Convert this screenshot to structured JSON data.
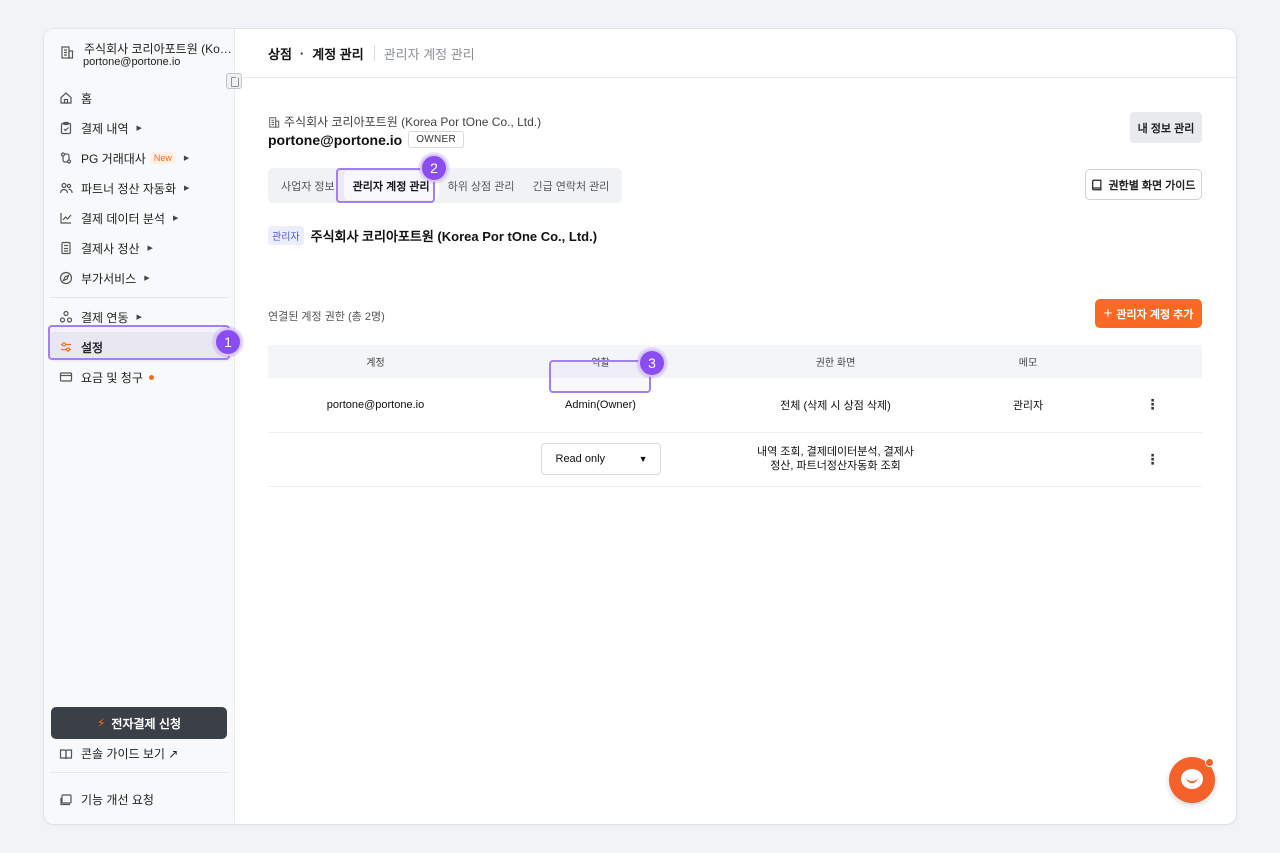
{
  "sidebar": {
    "org_name": "주식회사 코리아포트원 (Korea Por tOne Co., Ltd.)",
    "org_email": "portone@portone.io",
    "items": [
      {
        "label": "홈",
        "icon": "home-icon",
        "caret": false
      },
      {
        "label": "결제 내역",
        "icon": "clipboard-check-icon",
        "caret": true
      },
      {
        "label": "PG 거래대사",
        "icon": "reconcile-icon",
        "caret": true,
        "badge": "New"
      },
      {
        "label": "파트너 정산 자동화",
        "icon": "users-icon",
        "caret": true
      },
      {
        "label": "결제 데이터 분석",
        "icon": "chart-line-icon",
        "caret": true
      },
      {
        "label": "결제사 정산",
        "icon": "calculator-icon",
        "caret": true
      },
      {
        "label": "부가서비스",
        "icon": "compass-icon",
        "caret": true
      }
    ],
    "items2": [
      {
        "label": "결제 연동",
        "icon": "integration-icon",
        "caret": true
      },
      {
        "label": "설정",
        "icon": "settings-sliders-icon",
        "caret": false,
        "active": true
      },
      {
        "label": "요금 및 청구",
        "icon": "credit-card-icon",
        "caret": false,
        "dot": true
      }
    ],
    "apply_button": "전자결제 신청",
    "guide_link": "콘솔 가이드 보기 ↗",
    "feedback": "기능 개선 요청"
  },
  "header": {
    "crumb_main": "상점",
    "crumb_dot": "·",
    "crumb_sub": "계정 관리",
    "crumb_current": "관리자 계정 관리"
  },
  "main": {
    "org_name": "주식회사 코리아포트원 (Korea Por tOne Co., Ltd.)",
    "email": "portone@portone.io",
    "owner_tag": "OWNER",
    "my_info_button": "내 정보 관리",
    "tabs": [
      "사업자 정보",
      "관리자 계정 관리",
      "하위 상점 관리",
      "긴급 연락처 관리"
    ],
    "active_tab": 1,
    "guide_button": "권한별 화면 가이드",
    "admin_tag": "관리자",
    "admin_name": "주식회사 코리아포트원 (Korea Por tOne Co., Ltd.)",
    "linked_label": "연결된 계정 권한 (총 2명)",
    "add_button": "관리자 계정 추가",
    "table": {
      "headers": [
        "계정",
        "역할",
        "권한 화면",
        "메모",
        ""
      ],
      "rows": [
        {
          "account": "portone@portone.io",
          "role": "Admin(Owner)",
          "screens": "전체 (삭제 시 상점 삭제)",
          "memo": "관리자"
        },
        {
          "account": "",
          "role": "Read only",
          "screens": "내역 조회, 결제데이터분석, 결제사정산, 파트너정산자동화 조회",
          "memo": ""
        }
      ]
    }
  },
  "steps": [
    "1",
    "2",
    "3"
  ],
  "colors": {
    "accent_orange": "#fb6a25",
    "highlight_purple": "#8a4df2",
    "sidebar_bg": "#f8f9fa",
    "dark_button": "#3a3f48"
  }
}
